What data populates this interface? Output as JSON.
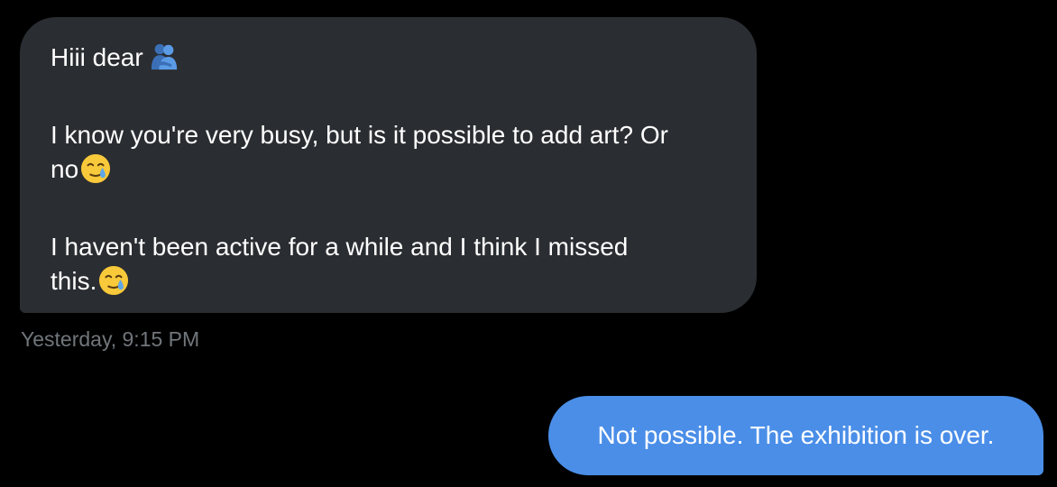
{
  "messages": {
    "received": {
      "greeting": "Hiii dear",
      "greeting_emoji": "people-hugging-icon",
      "line1": "I know you're very busy, but is it possible to add art? Or",
      "line2": "no",
      "line2_emoji": "face-holding-back-tears-icon",
      "line3": "I haven't been active for a while and I think I missed",
      "line4": "this.",
      "line4_emoji": "face-holding-back-tears-icon",
      "timestamp": "Yesterday, 9:15 PM"
    },
    "sent": {
      "text": "Not possible. The exhibition is over."
    }
  },
  "colors": {
    "background": "#000000",
    "received_bubble": "#2a2d31",
    "sent_bubble": "#4a8ee8",
    "timestamp": "#71767b"
  }
}
